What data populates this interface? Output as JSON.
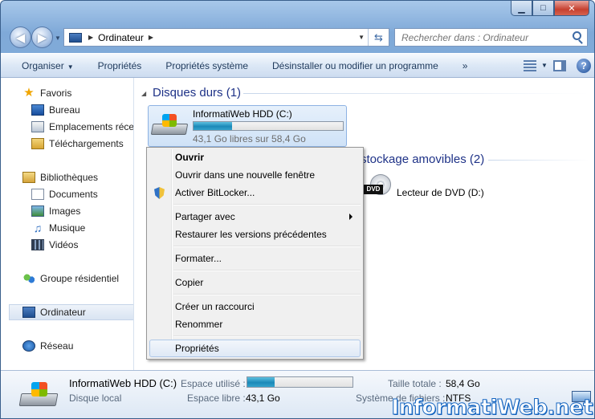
{
  "window": {
    "caption_min": "▁",
    "caption_max": "□",
    "caption_close": "✕"
  },
  "address": {
    "breadcrumb": "Ordinateur"
  },
  "search": {
    "placeholder": "Rechercher dans : Ordinateur"
  },
  "toolbar": {
    "items": [
      "Organiser",
      "Propriétés",
      "Propriétés système",
      "Désinstaller ou modifier un programme"
    ],
    "more": "»",
    "help": "?"
  },
  "sidebar": {
    "items": [
      {
        "label": "Favoris",
        "icon": "star-icon"
      },
      {
        "label": "Bureau",
        "icon": "desktop-icon"
      },
      {
        "label": "Emplacements récents",
        "icon": "recent-places-icon"
      },
      {
        "label": "Téléchargements",
        "icon": "downloads-icon"
      },
      {
        "label": "Bibliothèques",
        "icon": "libraries-icon"
      },
      {
        "label": "Documents",
        "icon": "documents-icon"
      },
      {
        "label": "Images",
        "icon": "images-icon"
      },
      {
        "label": "Musique",
        "icon": "music-icon"
      },
      {
        "label": "Vidéos",
        "icon": "videos-icon"
      },
      {
        "label": "Groupe résidentiel",
        "icon": "homegroup-icon"
      },
      {
        "label": "Ordinateur",
        "icon": "computer-icon"
      },
      {
        "label": "Réseau",
        "icon": "network-icon"
      }
    ]
  },
  "content": {
    "group_hdd": "Disques durs (1)",
    "group_removable": "stockage amovibles (2)",
    "drive_c": {
      "name": "InformatiWeb HDD (C:)",
      "free_text": "43,1 Go libres sur 58,4 Go",
      "used_fraction": 0.26
    },
    "dvd": {
      "badge": "DVD",
      "name": "Lecteur de DVD (D:)"
    }
  },
  "context_menu": {
    "open": "Ouvrir",
    "open_new_window": "Ouvrir dans une nouvelle fenêtre",
    "bitlocker": "Activer BitLocker...",
    "share_with": "Partager avec",
    "restore_versions": "Restaurer les versions précédentes",
    "format": "Formater...",
    "copy": "Copier",
    "create_shortcut": "Créer un raccourci",
    "rename": "Renommer",
    "properties": "Propriétés"
  },
  "details": {
    "name": "InformatiWeb HDD (C:)",
    "type": "Disque local",
    "used_label": "Espace utilisé :",
    "free_label": "Espace libre :",
    "free_value": "43,1 Go",
    "total_label": "Taille totale :",
    "total_value": "58,4 Go",
    "fs_label": "Système de fichiers :",
    "fs_value": "NTFS",
    "used_fraction": 0.26
  },
  "watermark": "InformatiWeb.net"
}
